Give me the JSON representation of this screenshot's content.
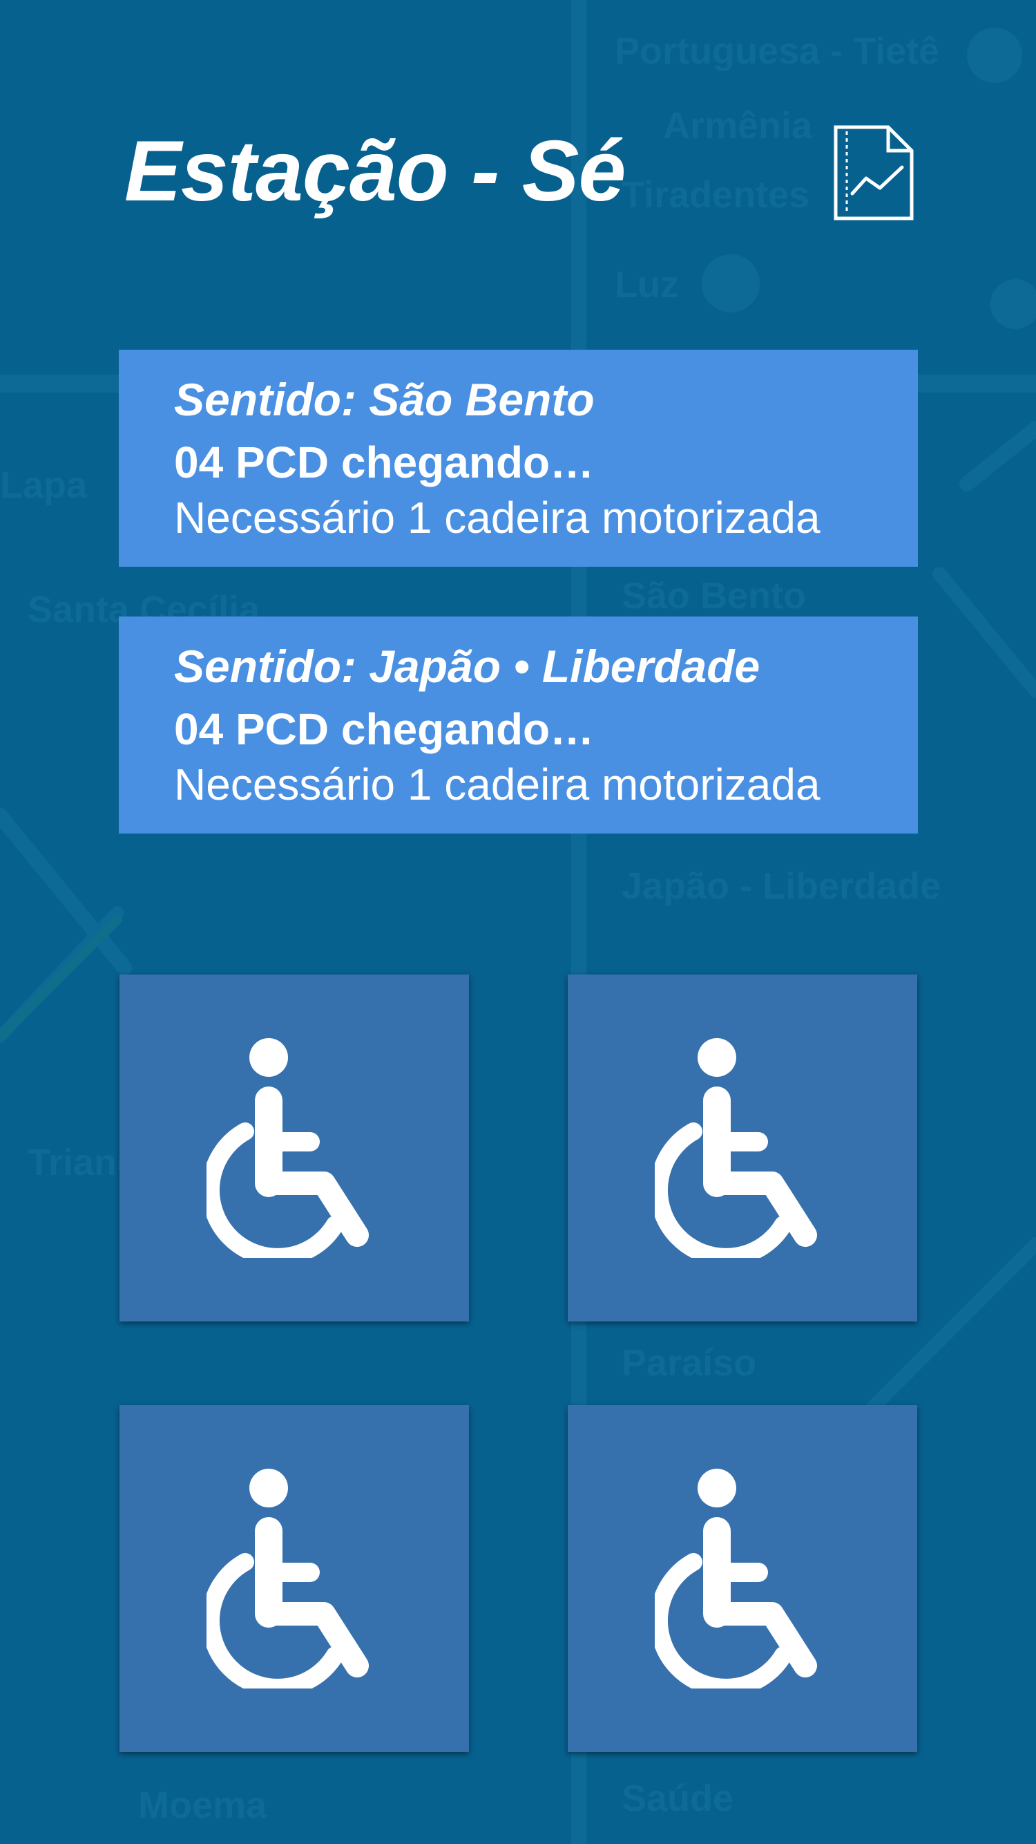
{
  "header": {
    "title": "Estação - Sé",
    "report_icon": "chart-document-icon"
  },
  "cards": [
    {
      "direction": "Sentido: São Bento",
      "pcd": "04 PCD chegando…",
      "need": "Necessário 1 cadeira motorizada"
    },
    {
      "direction": "Sentido: Japão • Liberdade",
      "pcd": "04 PCD chegando…",
      "need": "Necessário 1 cadeira motorizada"
    }
  ],
  "tiles": [
    {
      "icon": "wheelchair-icon"
    },
    {
      "icon": "wheelchair-icon"
    },
    {
      "icon": "wheelchair-icon"
    },
    {
      "icon": "wheelchair-icon"
    }
  ],
  "colors": {
    "background": "#07618f",
    "card": "#4a90e2",
    "tile": "#3771ad",
    "text": "#ffffff"
  }
}
